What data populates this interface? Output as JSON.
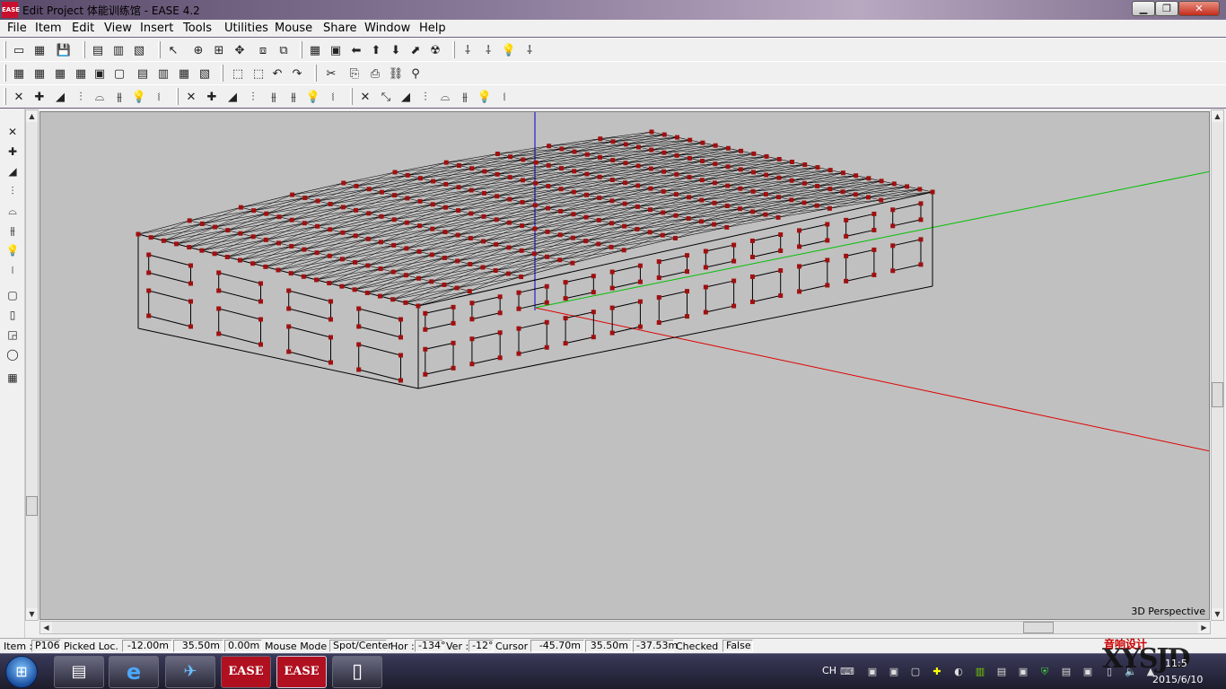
{
  "window": {
    "title": "Edit Project 体能训练馆 - EASE 4.2",
    "logo_text": "EASE",
    "min_glyph": "▁",
    "max_glyph": "❐",
    "close_glyph": "✕"
  },
  "menu": [
    "File",
    "Item",
    "Edit",
    "View",
    "Insert",
    "Tools",
    "Utilities",
    "Mouse",
    "Share",
    "Window",
    "Help"
  ],
  "toolbars": {
    "row1": [
      "▭",
      "▦",
      "💾",
      "▤",
      "▥",
      "▧",
      "↖",
      "⊕",
      "⊞",
      "✥",
      "⧈",
      "⧉",
      "▦",
      "▣",
      "⬅",
      "⬆",
      "⬇",
      "⬈",
      "☢",
      "⸸",
      "⸸",
      "💡",
      "⸸"
    ],
    "row2": [
      "▦",
      "▦",
      "▦",
      "▦",
      "▣",
      "▢",
      "▤",
      "▥",
      "▦",
      "▧",
      "⬚",
      "⬚",
      "↶",
      "↷",
      "✂",
      "⎘",
      "⎙",
      "⛓",
      "⚲"
    ],
    "row3": [
      "✕",
      "✚",
      "◢",
      "⫶",
      "⌓",
      "⫵",
      "💡",
      "⧙",
      "✕",
      "✚",
      "◢",
      "⫶",
      "⫵",
      "⫵",
      "💡",
      "⧙",
      "✕",
      "⤡",
      "◢",
      "⫶",
      "⌓",
      "⫵",
      "💡",
      "⧙"
    ]
  },
  "left_toolbar": [
    "✕",
    "✚",
    "◢",
    "⫶",
    "⌓",
    "⫵",
    "💡",
    "⧙",
    "▢",
    "▯",
    "◲",
    "◯",
    "▦"
  ],
  "viewport": {
    "label": "3D Perspective",
    "colors": {
      "background": "#c0c0c0",
      "structure": "#000000",
      "vertex": "#a01010",
      "axis_x": "#e00000",
      "axis_y": "#00c000",
      "axis_z": "#0000d0"
    }
  },
  "statusbar": {
    "item_label": "Item :",
    "item_value": "P106",
    "picked_label": "Picked Loc. :",
    "picked_x": "-12.00m ;",
    "picked_y": "35.50m ;",
    "picked_z": "0.00m",
    "mouse_mode_label": "Mouse Mode :",
    "mouse_mode_value": "Spot/Center",
    "hor_label": "Hor :",
    "hor_value": "-134°",
    "ver_label": "Ver :",
    "ver_value": "-12°",
    "cursor_label": "Cursor :",
    "cursor_x": "-45.70m ;",
    "cursor_y": "35.50m ;",
    "cursor_z": "-37.53m",
    "checked_label": "Checked :",
    "checked_value": "False"
  },
  "taskbar": {
    "start_glyph": "⊞",
    "apps": [
      {
        "name": "explorer",
        "glyph": "▤"
      },
      {
        "name": "ie",
        "glyph": "e"
      },
      {
        "name": "app-bird",
        "glyph": "✈"
      },
      {
        "name": "ease-1",
        "glyph": "EASE"
      },
      {
        "name": "ease-2",
        "glyph": "EASE"
      },
      {
        "name": "document",
        "glyph": "▯"
      }
    ],
    "lang": "CH",
    "tray_icons": [
      "⌨",
      "▣",
      "▣",
      "▢",
      "✚",
      "◐",
      "▥",
      "▤",
      "▣",
      "⛨",
      "▤",
      "▣",
      "▯",
      "🔈",
      "▲"
    ],
    "watermark": "音响设计",
    "brand": "XYSJD",
    "time": "11:5",
    "date": "2015/6/10"
  }
}
